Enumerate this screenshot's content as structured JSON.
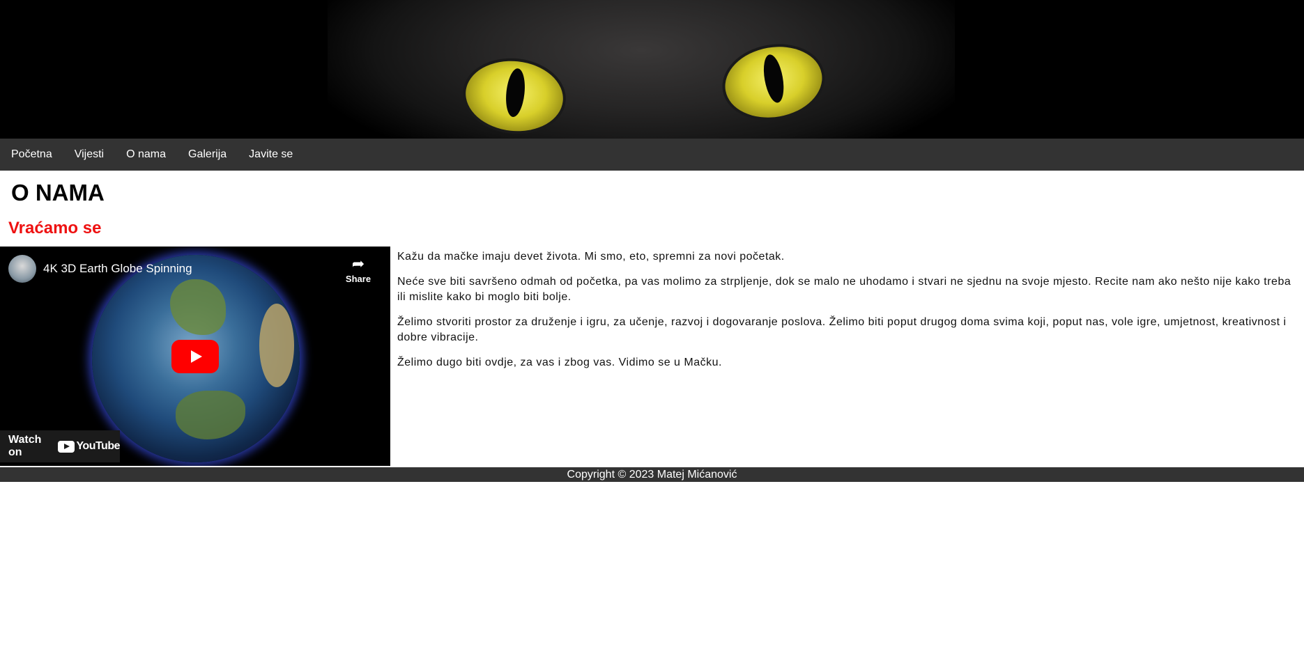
{
  "nav": {
    "items": [
      {
        "label": "Početna"
      },
      {
        "label": "Vijesti"
      },
      {
        "label": "O nama"
      },
      {
        "label": "Galerija"
      },
      {
        "label": "Javite se"
      }
    ]
  },
  "page": {
    "title": "O NAMA",
    "subtitle": "Vraćamo se"
  },
  "video": {
    "title": "4K 3D Earth Globe Spinning",
    "share_label": "Share",
    "watch_on_label": "Watch on",
    "youtube_label": "YouTube"
  },
  "content": {
    "paragraphs": [
      "Kažu da mačke imaju devet života. Mi smo, eto, spremni za novi početak.",
      "Neće sve biti savršeno odmah od početka, pa vas molimo za strpljenje, dok se malo ne uhodamo i stvari ne sjednu na svoje mjesto. Recite nam ako nešto nije kako treba ili mislite kako bi moglo biti bolje.",
      "Želimo stvoriti prostor za druženje i igru, za učenje, razvoj i dogovaranje poslova. Želimo biti poput drugog doma svima koji, poput nas, vole igre, umjetnost, kreativnost i dobre vibracije.",
      "Želimo dugo biti ovdje, za vas i zbog vas. Vidimo se u Mačku."
    ]
  },
  "footer": {
    "copyright": "Copyright © 2023 Matej Mićanović"
  },
  "colors": {
    "nav_bg": "#333333",
    "subtitle": "#ee1111",
    "youtube_red": "#ff0000"
  }
}
